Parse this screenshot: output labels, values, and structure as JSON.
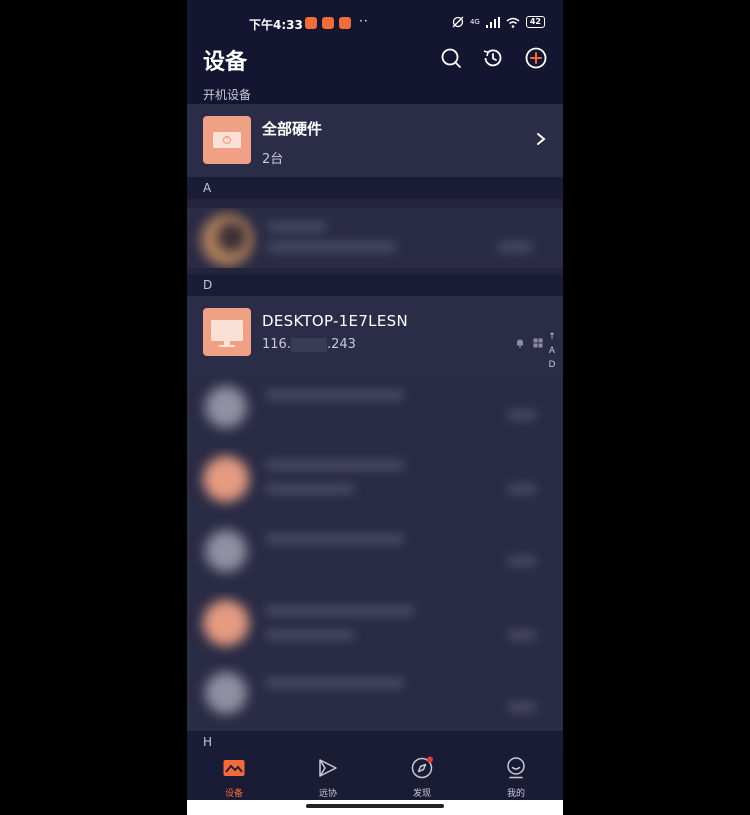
{
  "status_bar": {
    "time": "下午4:33",
    "dots": "··",
    "network": "4G",
    "battery": "42"
  },
  "header": {
    "title": "设备",
    "subtitle": "开机设备"
  },
  "all_hardware": {
    "title": "全部硬件",
    "count": "2台"
  },
  "sections": {
    "a": "A",
    "d": "D",
    "h": "H"
  },
  "device": {
    "name": "DESKTOP-1E7LESN",
    "ip_prefix": "116.",
    "ip_suffix": ".243"
  },
  "index_bar": {
    "arrow": "↑",
    "letters": [
      "A",
      "D"
    ]
  },
  "bottom_nav": {
    "items": [
      {
        "label": "设备",
        "icon": "device-icon",
        "active": true
      },
      {
        "label": "远协",
        "icon": "remote-assist-icon",
        "active": false
      },
      {
        "label": "发现",
        "icon": "compass-icon",
        "active": false,
        "badge": true
      },
      {
        "label": "我的",
        "icon": "profile-icon",
        "active": false
      }
    ]
  },
  "colors": {
    "accent": "#f26b3a",
    "tile": "#f0a084",
    "background": "#24253d",
    "header": "#141530"
  }
}
